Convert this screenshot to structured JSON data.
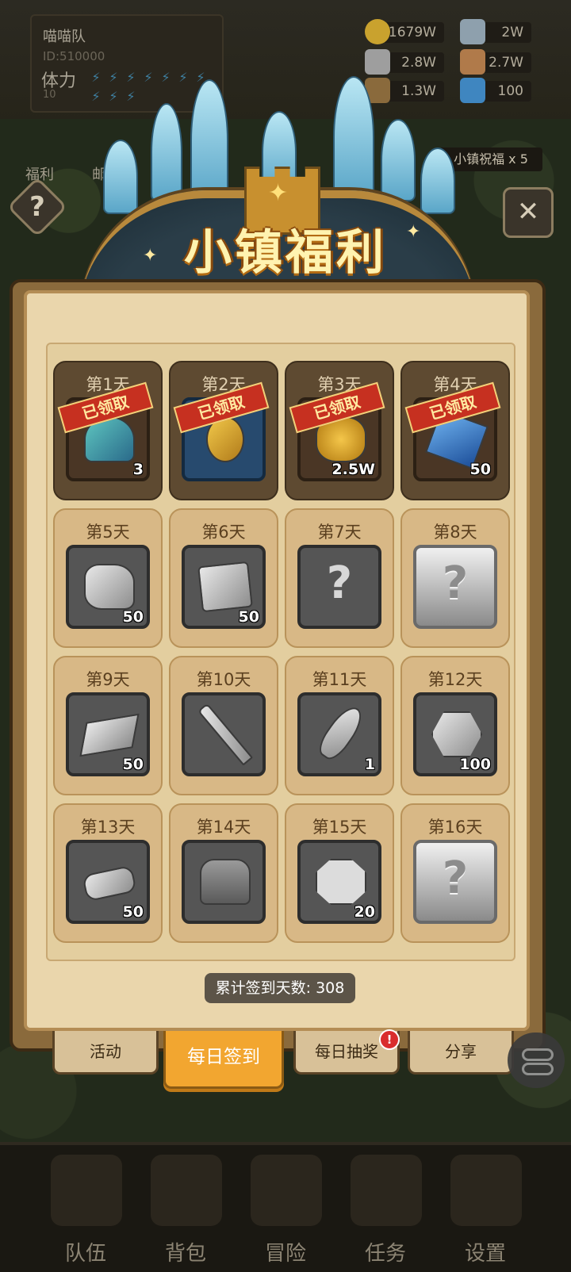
{
  "player": {
    "name": "喵喵队",
    "id": "ID:510000",
    "stamina_label": "体力",
    "stamina_value": "10"
  },
  "resources": [
    {
      "value": "1679W",
      "icon": "gold-coin-icon",
      "color": "#c9a22e"
    },
    {
      "value": "2W",
      "icon": "metal-ingot-icon",
      "color": "#8ea0ad"
    },
    {
      "value": "2.8W",
      "icon": "ore-stone-icon",
      "color": "#9e9e9e"
    },
    {
      "value": "2.7W",
      "icon": "cloth-scroll-icon",
      "color": "#b07a4a"
    },
    {
      "value": "1.3W",
      "icon": "wood-icon",
      "color": "#8a6a3c"
    },
    {
      "value": "100",
      "icon": "blue-gem-icon",
      "color": "#3f86c0"
    }
  ],
  "side": {
    "welfare": "福利",
    "mail": "邮",
    "blessing": "小镇祝福 x 5"
  },
  "title": "小镇福利",
  "days": [
    {
      "label": "第1天",
      "count": "3",
      "claimed": true,
      "stamp": "已领取",
      "icon": "potion-icon"
    },
    {
      "label": "第2天",
      "count": "",
      "claimed": true,
      "stamp": "已领取",
      "icon": "key-icon"
    },
    {
      "label": "第3天",
      "count": "2.5W",
      "claimed": true,
      "stamp": "已领取",
      "icon": "gold-pile-icon"
    },
    {
      "label": "第4天",
      "count": "50",
      "claimed": true,
      "stamp": "已领取",
      "icon": "blue-crystal-icon"
    },
    {
      "label": "第5天",
      "count": "50",
      "claimed": false,
      "stamp": "",
      "icon": "stone-ore-icon"
    },
    {
      "label": "第6天",
      "count": "50",
      "claimed": false,
      "stamp": "",
      "icon": "fabric-icon"
    },
    {
      "label": "第7天",
      "count": "",
      "claimed": false,
      "stamp": "",
      "icon": "mystery-icon"
    },
    {
      "label": "第8天",
      "count": "",
      "claimed": false,
      "stamp": "",
      "icon": "mystery-silver-icon"
    },
    {
      "label": "第9天",
      "count": "50",
      "claimed": false,
      "stamp": "",
      "icon": "ingot-icon"
    },
    {
      "label": "第10天",
      "count": "",
      "claimed": false,
      "stamp": "",
      "icon": "sword-icon"
    },
    {
      "label": "第11天",
      "count": "1",
      "claimed": false,
      "stamp": "",
      "icon": "feather-icon"
    },
    {
      "label": "第12天",
      "count": "100",
      "claimed": false,
      "stamp": "",
      "icon": "rune-gem-icon"
    },
    {
      "label": "第13天",
      "count": "50",
      "claimed": false,
      "stamp": "",
      "icon": "log-icon"
    },
    {
      "label": "第14天",
      "count": "",
      "claimed": false,
      "stamp": "",
      "icon": "backpack-icon"
    },
    {
      "label": "第15天",
      "count": "20",
      "claimed": false,
      "stamp": "",
      "icon": "emblem-stone-icon"
    },
    {
      "label": "第16天",
      "count": "",
      "claimed": false,
      "stamp": "",
      "icon": "mystery-silver-icon"
    }
  ],
  "total_checkin": "累计签到天数: 308",
  "tabs": [
    {
      "label": "活动",
      "active": false,
      "badge": ""
    },
    {
      "label": "每日签到",
      "active": true,
      "badge": ""
    },
    {
      "label": "每日抽奖",
      "active": false,
      "badge": "!"
    },
    {
      "label": "分享",
      "active": false,
      "badge": ""
    }
  ],
  "nav": [
    {
      "label": "队伍",
      "icon": "helmet-icon"
    },
    {
      "label": "背包",
      "icon": "bag-icon"
    },
    {
      "label": "冒险",
      "icon": "crossed-swords-icon"
    },
    {
      "label": "任务",
      "icon": "scroll-icon"
    },
    {
      "label": "设置",
      "icon": "gear-icon"
    }
  ],
  "colors": {
    "tab_active": "#f2a630",
    "stamp_red": "#c63020",
    "title_gold": "#fff3b0"
  }
}
